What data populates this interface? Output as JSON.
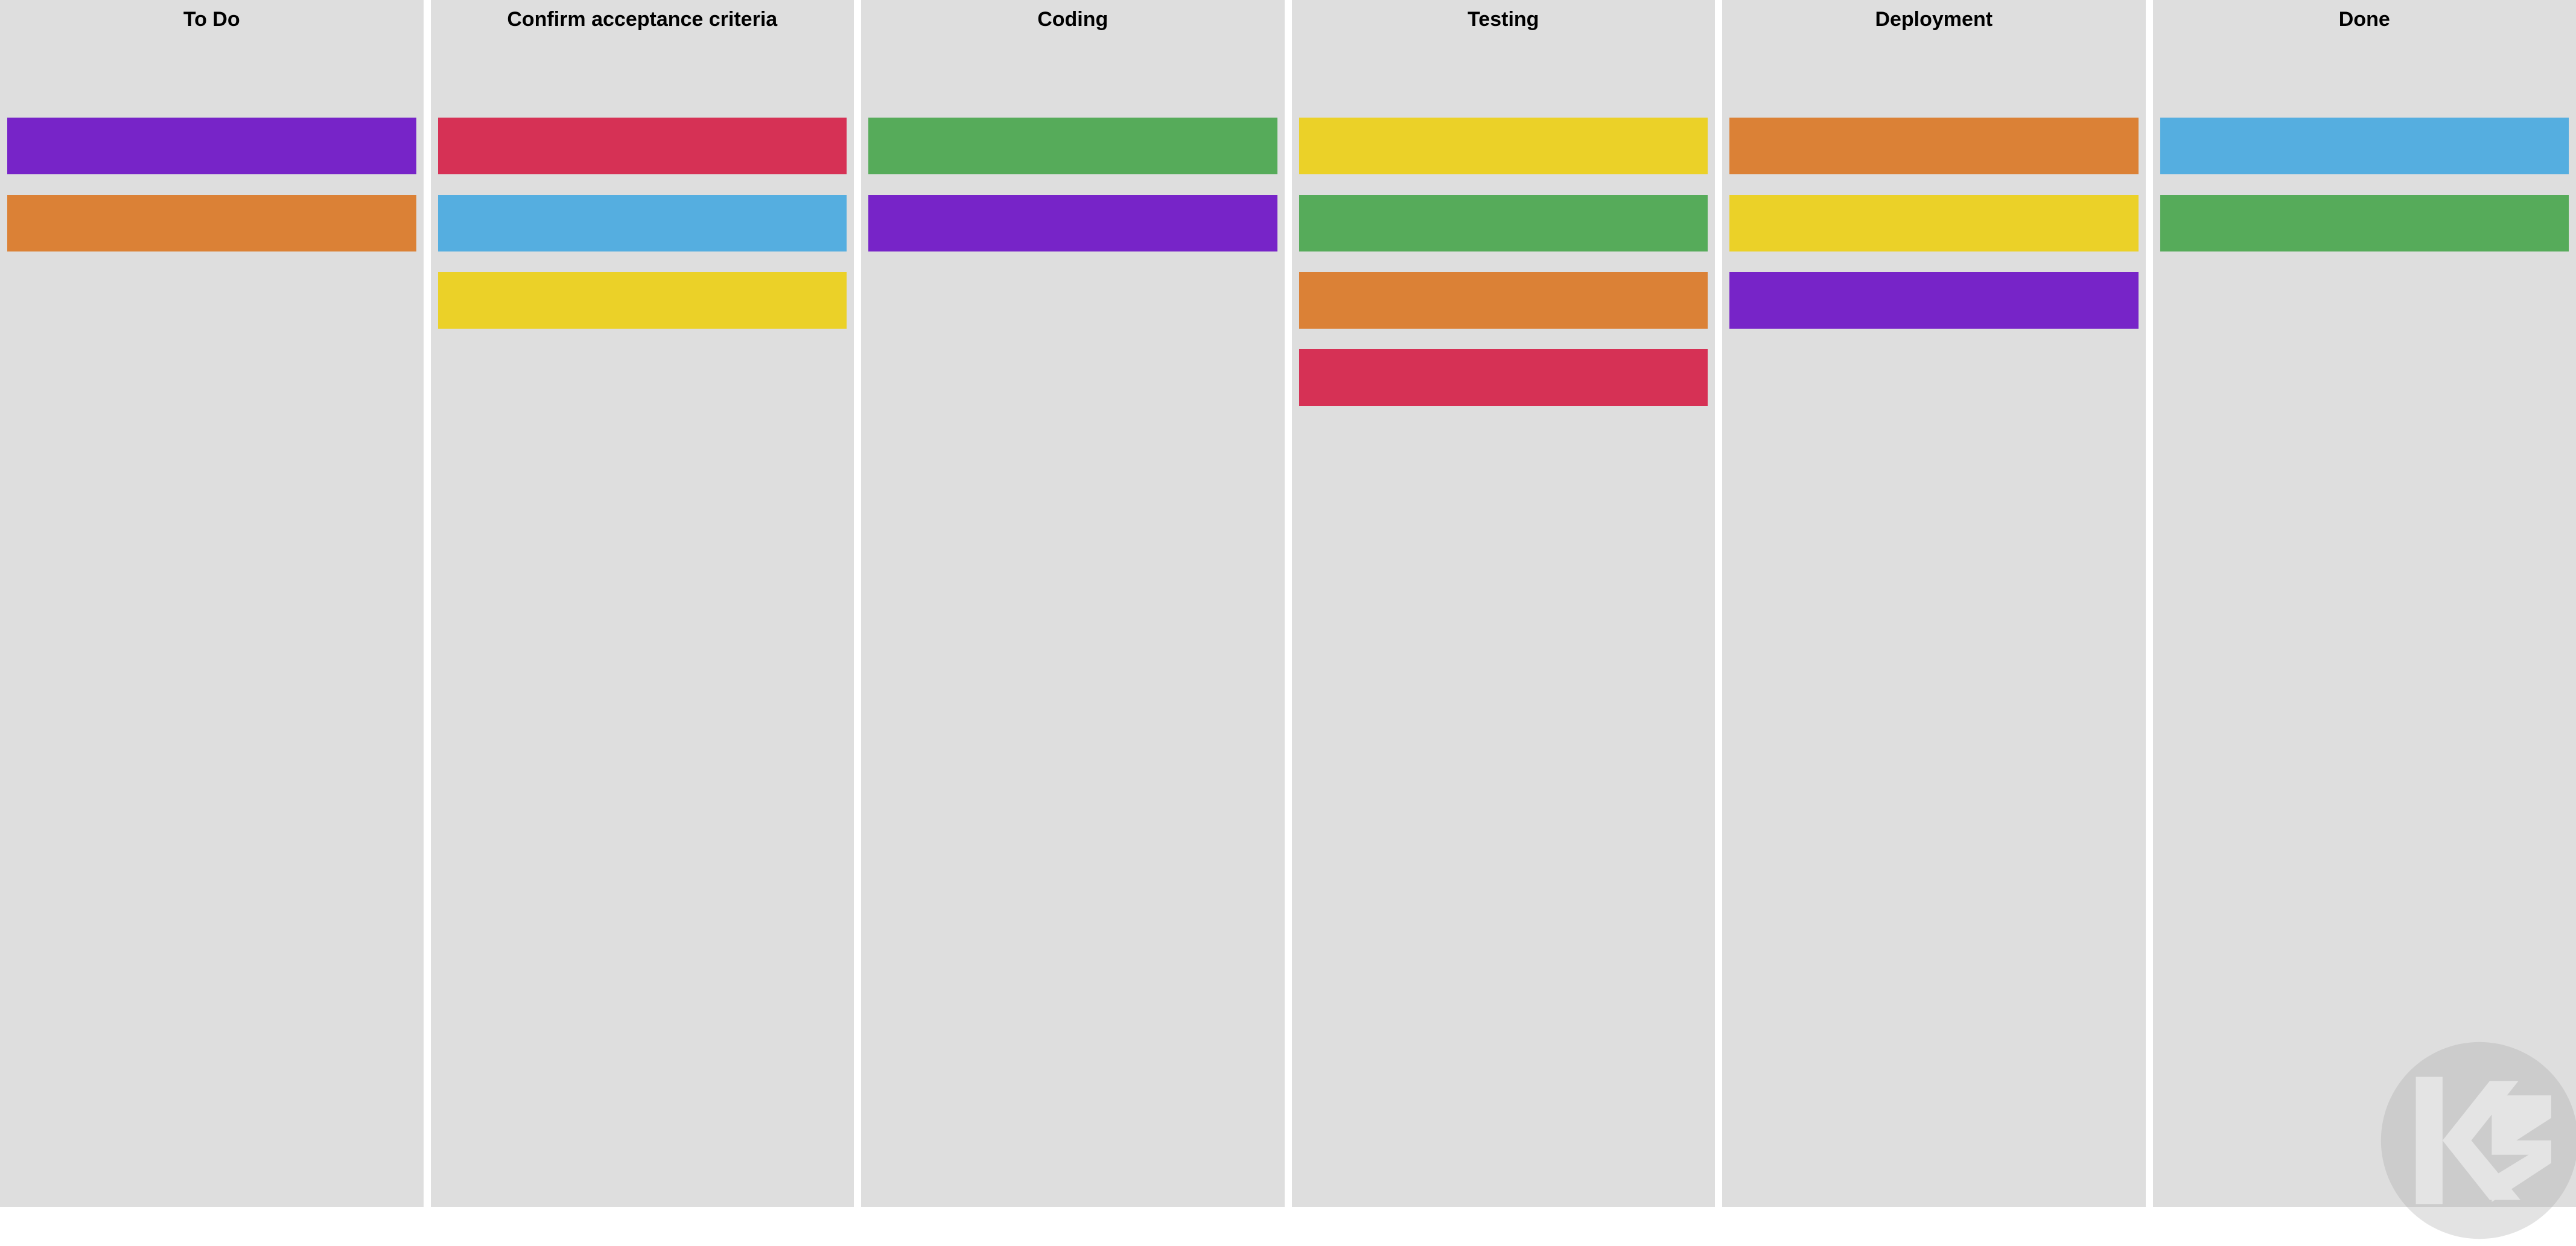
{
  "palette": {
    "purple": "#7724c8",
    "orange": "#db8136",
    "red": "#d63155",
    "blue": "#55aee0",
    "yellow": "#ebd128",
    "green": "#56ab5a"
  },
  "columns": [
    {
      "id": "todo",
      "title": "To Do",
      "cards": [
        "purple",
        "orange"
      ]
    },
    {
      "id": "confirm",
      "title": "Confirm acceptance criteria",
      "cards": [
        "red",
        "blue",
        "yellow"
      ]
    },
    {
      "id": "coding",
      "title": "Coding",
      "cards": [
        "green",
        "purple"
      ]
    },
    {
      "id": "testing",
      "title": "Testing",
      "cards": [
        "yellow",
        "green",
        "orange",
        "red"
      ]
    },
    {
      "id": "deployment",
      "title": "Deployment",
      "cards": [
        "orange",
        "yellow",
        "purple"
      ]
    },
    {
      "id": "done",
      "title": "Done",
      "cards": [
        "blue",
        "green"
      ]
    }
  ],
  "watermark": {
    "label": "kz-logo"
  }
}
